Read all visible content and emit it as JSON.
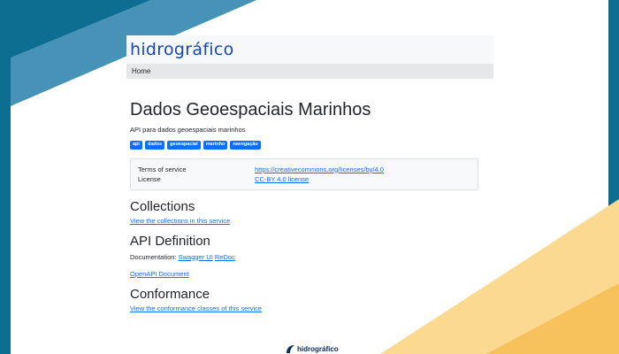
{
  "brand": {
    "logo_text": "hidrográfico"
  },
  "nav": {
    "home": "Home"
  },
  "title": "Dados Geoespaciais Marinhos",
  "subtitle": "API para dados geoespaciais marinhos",
  "tags": [
    "api",
    "dados",
    "geoespacial",
    "marinho",
    "navegação"
  ],
  "info": {
    "terms_label": "Terms of service",
    "terms_value": "https://creativecommons.org/licenses/by/4.0",
    "license_label": "License",
    "license_value": "CC-BY 4.0 license"
  },
  "collections": {
    "heading": "Collections",
    "link": "View the collections in this service"
  },
  "api_definition": {
    "heading": "API Definition",
    "doc_label": "Documentation:",
    "swagger": "Swagger UI",
    "redoc": "ReDoc",
    "openapi": "OpenAPI Document"
  },
  "conformance": {
    "heading": "Conformance",
    "link": "View the conformance classes of this service"
  },
  "footer": {
    "logo_text": "hidrográfico"
  },
  "colors": {
    "accent": "#0d6efd",
    "brand": "#1746b8",
    "teal": "#0e6e91",
    "sand": "#f7c25c"
  }
}
